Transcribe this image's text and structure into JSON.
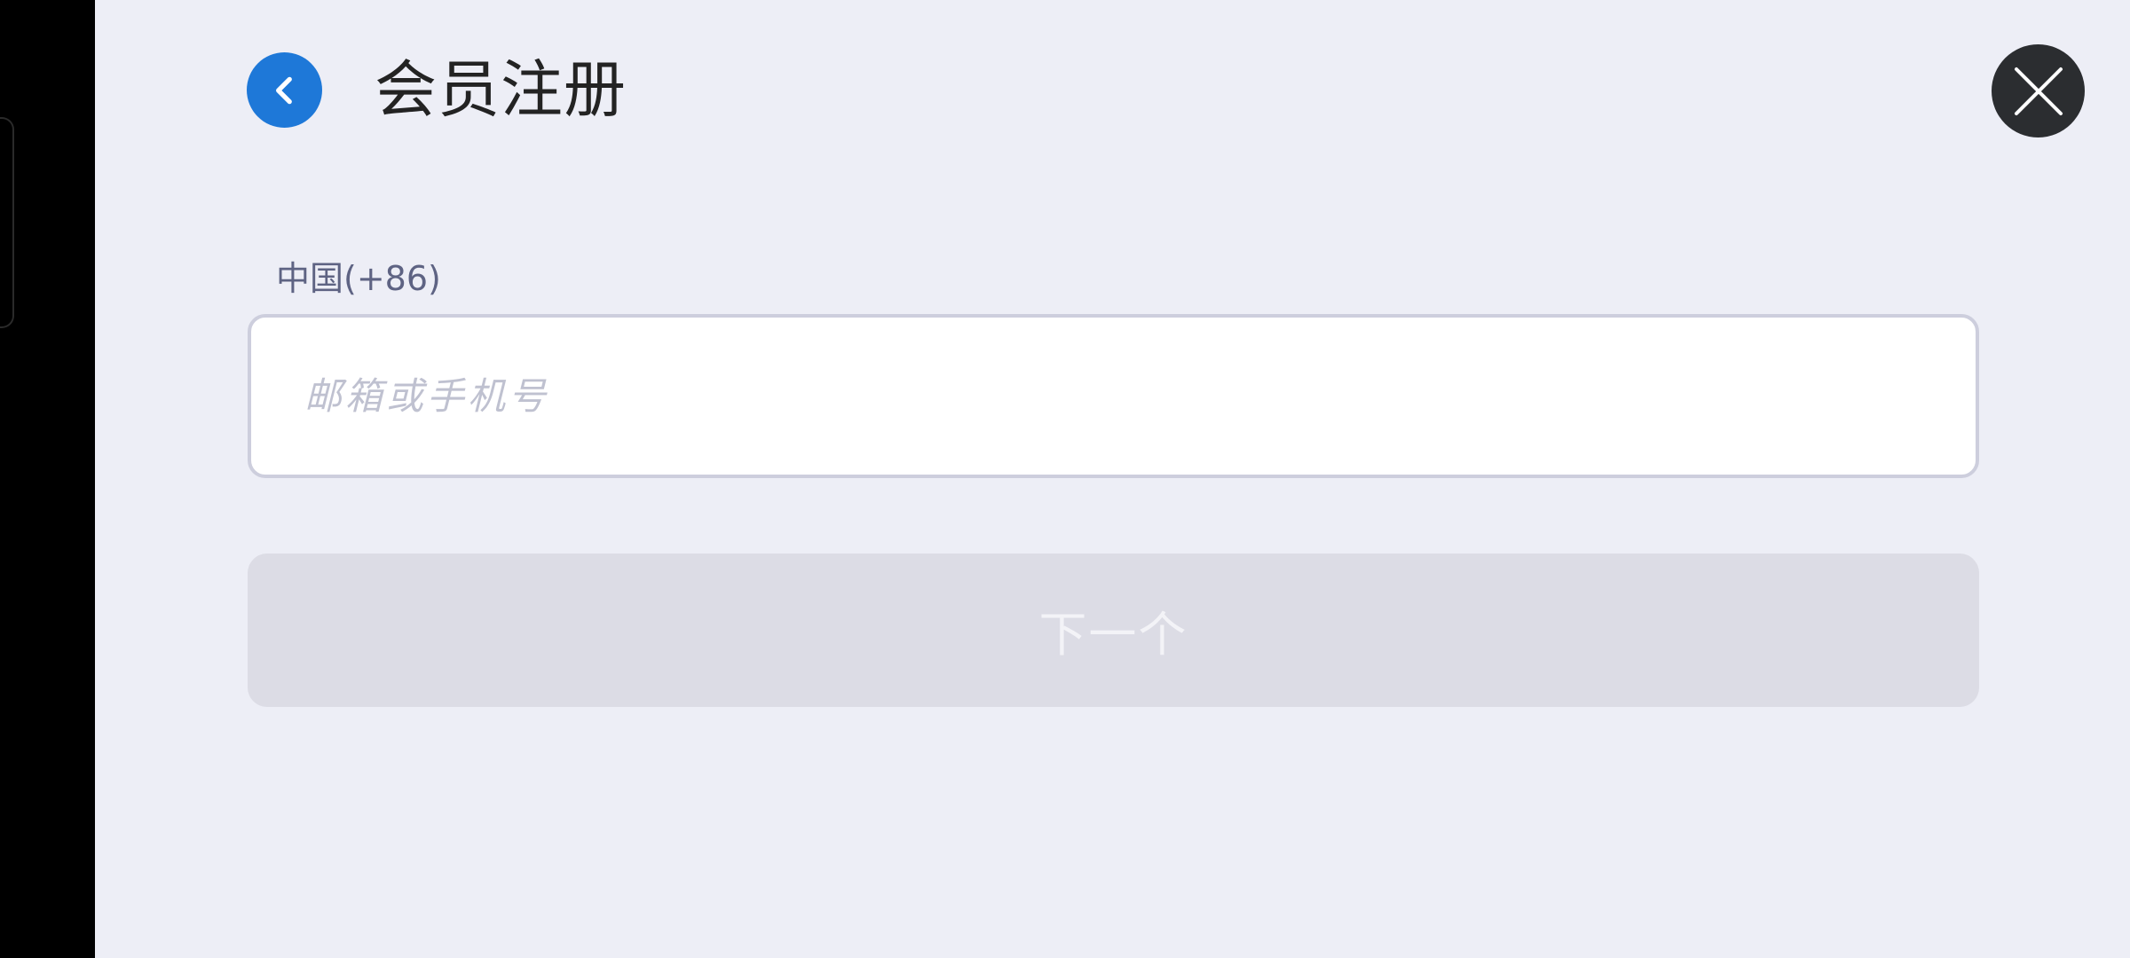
{
  "header": {
    "title": "会员注册",
    "back_icon": "chevron-left-icon",
    "close_icon": "close-icon"
  },
  "form": {
    "country_code": "中国(+86)",
    "account_input": {
      "value": "",
      "placeholder": "邮箱或手机号"
    },
    "next_label": "下一个",
    "next_enabled": false
  },
  "colors": {
    "accent": "#1E78D8",
    "background": "#EDEEF6",
    "close_button": "#2B2D30",
    "disabled_button": "#DCDCE5",
    "label_text": "#5E6383"
  }
}
